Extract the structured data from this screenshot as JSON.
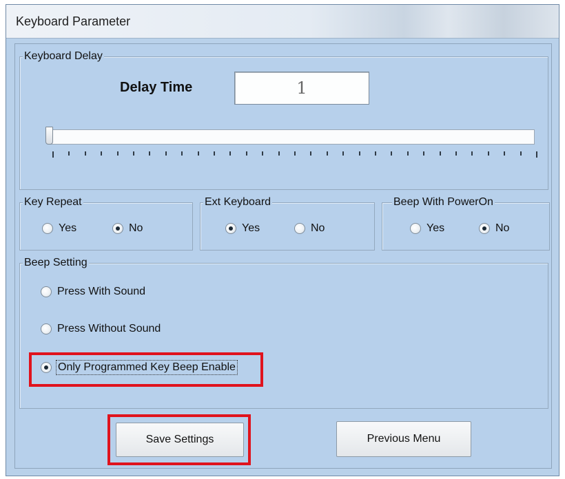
{
  "window": {
    "title": "Keyboard Parameter"
  },
  "keyboard_delay": {
    "legend": "Keyboard Delay",
    "label": "Delay Time",
    "value": "1",
    "slider": {
      "min": 1,
      "max": 31,
      "value": 1,
      "tick_count": 31
    }
  },
  "key_repeat": {
    "legend": "Key Repeat",
    "options": [
      {
        "label": "Yes",
        "checked": false
      },
      {
        "label": "No",
        "checked": true
      }
    ]
  },
  "ext_keyboard": {
    "legend": "Ext Keyboard",
    "options": [
      {
        "label": "Yes",
        "checked": true
      },
      {
        "label": "No",
        "checked": false
      }
    ]
  },
  "beep_poweron": {
    "legend": "Beep With PowerOn",
    "options": [
      {
        "label": "Yes",
        "checked": false
      },
      {
        "label": "No",
        "checked": true
      }
    ]
  },
  "beep_setting": {
    "legend": "Beep Setting",
    "options": [
      {
        "label": "Press With Sound",
        "checked": false
      },
      {
        "label": "Press Without Sound",
        "checked": false
      },
      {
        "label": "Only Programmed Key Beep Enable",
        "checked": true
      }
    ]
  },
  "buttons": {
    "save": "Save Settings",
    "previous": "Previous Menu"
  },
  "colors": {
    "highlight": "#e0131d",
    "window_bg": "#b9d1ea"
  }
}
